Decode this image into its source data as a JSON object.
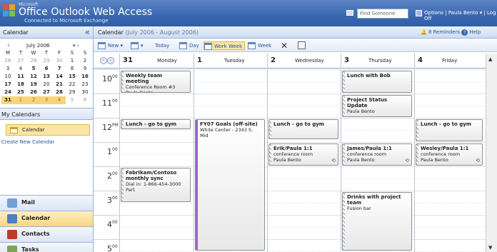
{
  "app": {
    "brand_small": "Microsoft",
    "title": "Office Outlook Web Access",
    "subtitle": "Connected to Microsoft Exchange",
    "find_placeholder": "Find Someone",
    "options_text": "Options | Paula Bento ▾ | Log Off"
  },
  "left": {
    "header": "Calendar",
    "collapse_icon": "«",
    "minical": {
      "month": "July 2006",
      "prev": "‹",
      "next": "▾ ›",
      "dows": [
        "M",
        "T",
        "W",
        "T",
        "F",
        "S",
        "S"
      ],
      "weeks": [
        [
          {
            "d": "26",
            "c": "dim"
          },
          {
            "d": "27",
            "c": "dim"
          },
          {
            "d": "28",
            "c": "dim"
          },
          {
            "d": "29",
            "c": "dim"
          },
          {
            "d": "30",
            "c": "dim"
          },
          {
            "d": "1",
            "c": ""
          },
          {
            "d": "2",
            "c": ""
          }
        ],
        [
          {
            "d": "3",
            "c": ""
          },
          {
            "d": "4",
            "c": ""
          },
          {
            "d": "5",
            "c": "b"
          },
          {
            "d": "6",
            "c": "b"
          },
          {
            "d": "7",
            "c": "b"
          },
          {
            "d": "8",
            "c": ""
          },
          {
            "d": "9",
            "c": ""
          }
        ],
        [
          {
            "d": "10",
            "c": ""
          },
          {
            "d": "11",
            "c": "b"
          },
          {
            "d": "12",
            "c": "b"
          },
          {
            "d": "13",
            "c": "b"
          },
          {
            "d": "14",
            "c": "b"
          },
          {
            "d": "15",
            "c": "b"
          },
          {
            "d": "16",
            "c": "b"
          }
        ],
        [
          {
            "d": "17",
            "c": "b"
          },
          {
            "d": "18",
            "c": "b"
          },
          {
            "d": "19",
            "c": "b"
          },
          {
            "d": "20",
            "c": ""
          },
          {
            "d": "21",
            "c": "b"
          },
          {
            "d": "22",
            "c": ""
          },
          {
            "d": "23",
            "c": ""
          }
        ],
        [
          {
            "d": "24",
            "c": "b"
          },
          {
            "d": "25",
            "c": "b"
          },
          {
            "d": "26",
            "c": "b"
          },
          {
            "d": "27",
            "c": "b"
          },
          {
            "d": "28",
            "c": "b"
          },
          {
            "d": "29",
            "c": ""
          },
          {
            "d": "30",
            "c": ""
          }
        ],
        [
          {
            "d": "31",
            "c": "b wk"
          },
          {
            "d": "1",
            "c": "dim wk"
          },
          {
            "d": "2",
            "c": "dim wk"
          },
          {
            "d": "3",
            "c": "dim wk"
          },
          {
            "d": "4",
            "c": "dim wk"
          },
          {
            "d": "5",
            "c": "dim"
          },
          {
            "d": "6",
            "c": "dim"
          }
        ]
      ]
    },
    "my_calendars": "My Calendars",
    "calendar_item": "Calendar",
    "create_new": "Create New Calendar",
    "grip": "........",
    "nav": [
      {
        "label": "Mail",
        "icon": "mail-icon",
        "color": "#6fa0d8",
        "active": false
      },
      {
        "label": "Calendar",
        "icon": "calendar-icon",
        "color": "#4f7fc6",
        "active": true
      },
      {
        "label": "Contacts",
        "icon": "contacts-icon",
        "color": "#c0392b",
        "active": false
      },
      {
        "label": "Tasks",
        "icon": "tasks-icon",
        "color": "#7aa35a",
        "active": false
      }
    ]
  },
  "main": {
    "header_title": "Calendar",
    "header_range": "(July 2006 - August 2006)",
    "reminders": "8 Reminders ▾",
    "help": "Help",
    "toolbar": {
      "new": "New ▾",
      "new_view": "▾",
      "today": "Today",
      "day": "Day",
      "work_week": "Work Week",
      "week": "Week",
      "delete": "✕"
    },
    "days": [
      {
        "num": "31",
        "name": "Monday"
      },
      {
        "num": "1",
        "name": "Tuesday"
      },
      {
        "num": "2",
        "name": "Wednesday"
      },
      {
        "num": "3",
        "name": "Thursday"
      },
      {
        "num": "4",
        "name": "Friday"
      }
    ],
    "hours": [
      {
        "h": "10",
        "s": "00"
      },
      {
        "h": "11",
        "s": "00"
      },
      {
        "h": "12",
        "s": "PM"
      },
      {
        "h": "1",
        "s": "00"
      },
      {
        "h": "2",
        "s": "00"
      },
      {
        "h": "3",
        "s": "00"
      },
      {
        "h": "4",
        "s": "00"
      },
      {
        "h": "5",
        "s": "00"
      }
    ],
    "appointments": [
      {
        "day": 0,
        "start": 0.0,
        "dur": 1.0,
        "title": "Weekly team meeting",
        "lines": [
          "Conference Room #3",
          "Paula Bento"
        ],
        "style": "busy",
        "recurring": false
      },
      {
        "day": 0,
        "start": 2.0,
        "dur": 0.5,
        "title": "Lunch - go to gym",
        "lines": [],
        "style": "busy",
        "recurring": false
      },
      {
        "day": 0,
        "start": 4.0,
        "dur": 1.5,
        "title": "Fabrikam/Contoso monthly sync",
        "lines": [
          "Dial in: 1-866-454-3000 Part"
        ],
        "style": "busy",
        "recurring": false
      },
      {
        "day": 1,
        "start": 2.0,
        "dur": 5.5,
        "title": "FY07 Goals (off-site)",
        "lines": [
          "White Center - 2343 S. Mid"
        ],
        "style": "tent",
        "recurring": false
      },
      {
        "day": 2,
        "start": 2.0,
        "dur": 0.9,
        "title": "Lunch - go to gym",
        "lines": [],
        "style": "busy",
        "recurring": false
      },
      {
        "day": 2,
        "start": 3.0,
        "dur": 1.0,
        "title": "Erik/Paula 1:1",
        "lines": [
          "conference room",
          "Paula Bento"
        ],
        "style": "busy",
        "recurring": true
      },
      {
        "day": 3,
        "start": 0.0,
        "dur": 1.0,
        "title": "Lunch with Bob",
        "lines": [],
        "style": "busy",
        "recurring": false
      },
      {
        "day": 3,
        "start": 1.0,
        "dur": 1.0,
        "title": "Project Status Update",
        "lines": [
          "Paula Bento"
        ],
        "style": "busy",
        "recurring": false
      },
      {
        "day": 3,
        "start": 3.0,
        "dur": 1.0,
        "title": "James/Paula 1:1",
        "lines": [
          "conference room",
          "Paula Bento"
        ],
        "style": "busy",
        "recurring": true
      },
      {
        "day": 3,
        "start": 5.0,
        "dur": 2.5,
        "title": "Drinks with project team",
        "lines": [
          "Fusion bar"
        ],
        "style": "busy",
        "recurring": false
      },
      {
        "day": 4,
        "start": 2.0,
        "dur": 1.0,
        "title": "Lunch - go to gym",
        "lines": [],
        "style": "busy",
        "recurring": false
      },
      {
        "day": 4,
        "start": 3.0,
        "dur": 1.0,
        "title": "Wesley/Paula 1:1",
        "lines": [
          "conference room",
          "Paula Bento"
        ],
        "style": "busy",
        "recurring": true
      }
    ],
    "recur_glyph": "⟲"
  },
  "colors": {
    "accent": "#3a68b0",
    "highlight": "#fbe5a4",
    "tentative": "#9b63c9"
  }
}
